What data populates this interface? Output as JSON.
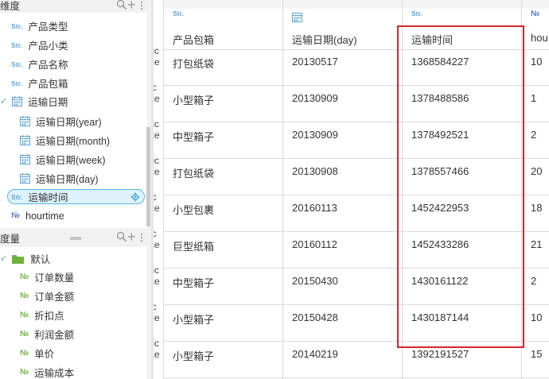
{
  "dimension_panel": {
    "title": "维度",
    "fields": [
      {
        "type": "Str.",
        "label": "产品类型"
      },
      {
        "type": "Str.",
        "label": "产品小类"
      },
      {
        "type": "Str.",
        "label": "产品名称"
      },
      {
        "type": "Str.",
        "label": "产品包箱"
      },
      {
        "type": "date",
        "label": "运输日期",
        "expanded": true
      },
      {
        "type": "date",
        "label": "运输日期(year)"
      },
      {
        "type": "date",
        "label": "运输日期(month)"
      },
      {
        "type": "date",
        "label": "运输日期(week)"
      },
      {
        "type": "date",
        "label": "运输日期(day)"
      },
      {
        "type": "Str.",
        "label": "运输时间",
        "selected": true
      },
      {
        "type": "№",
        "label": "hourtime"
      }
    ]
  },
  "measure_panel": {
    "title": "度量",
    "folder": "默认",
    "fields": [
      {
        "type": "№",
        "label": "订单数量"
      },
      {
        "type": "№",
        "label": "订单金额"
      },
      {
        "type": "№",
        "label": "折扣点"
      },
      {
        "type": "№",
        "label": "利润金额"
      },
      {
        "type": "№",
        "label": "单价"
      },
      {
        "type": "№",
        "label": "运输成本"
      }
    ]
  },
  "type_tags": {
    "str": "Str.",
    "num": "№",
    "check": "✓"
  },
  "table": {
    "left_strip_text": [
      "fic\nce",
      "ic\nce",
      "fic\nce",
      "fic\nce",
      "ic\nce",
      "ic\nce",
      "fic\nce",
      "ic\nce",
      "fic\nce"
    ],
    "columns": [
      {
        "type": "Str.",
        "header": "产品包箱"
      },
      {
        "type": "date",
        "header": "运输日期(day)"
      },
      {
        "type": "Str.",
        "header": "运输时间"
      },
      {
        "type": "№",
        "header": "hou"
      }
    ],
    "rows": [
      [
        "打包纸袋",
        "20130517",
        "1368584227",
        "10"
      ],
      [
        "小型箱子",
        "20130909",
        "1378488586",
        "1"
      ],
      [
        "中型箱子",
        "20130909",
        "1378492521",
        "2"
      ],
      [
        "打包纸袋",
        "20130908",
        "1378557466",
        "20"
      ],
      [
        "小型包裹",
        "20160113",
        "1452422953",
        "18"
      ],
      [
        "巨型纸箱",
        "20160112",
        "1452433286",
        "21"
      ],
      [
        "中型箱子",
        "20150430",
        "1430161122",
        "2"
      ],
      [
        "小型箱子",
        "20150428",
        "1430187144",
        "10"
      ],
      [
        "小型箱子",
        "20140219",
        "1392191527",
        "15"
      ]
    ]
  },
  "colors": {
    "accent": "#3aa3e0",
    "string_tag": "#5aa3d6",
    "number_tag_blue": "#4a78c8",
    "number_tag_green": "#6db33f",
    "highlight_border": "#d8242b"
  }
}
